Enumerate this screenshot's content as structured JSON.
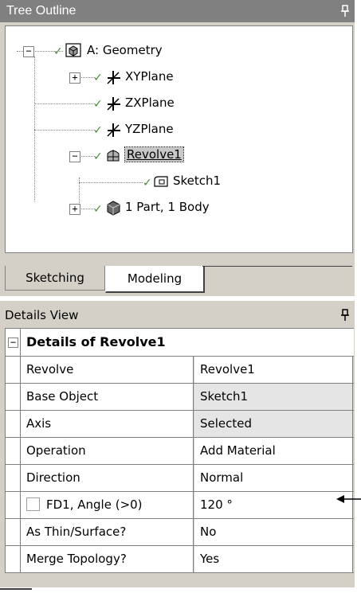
{
  "tree_panel": {
    "title": "Tree Outline",
    "nodes": [
      {
        "label": "A: Geometry",
        "expander": "−"
      },
      {
        "label": "XYPlane",
        "expander": "+"
      },
      {
        "label": "ZXPlane"
      },
      {
        "label": "YZPlane"
      },
      {
        "label": "Revolve1",
        "expander": "−",
        "selected": true
      },
      {
        "label": "Sketch1"
      },
      {
        "label": "1 Part, 1 Body",
        "expander": "+"
      }
    ],
    "tabs": {
      "sketching": "Sketching",
      "modeling": "Modeling",
      "active": "Modeling"
    }
  },
  "details_panel": {
    "title": "Details View",
    "header": "Details of Revolve1",
    "collapse": "−",
    "rows": [
      {
        "prop": "Revolve",
        "value": "Revolve1"
      },
      {
        "prop": "Base Object",
        "value": "Sketch1"
      },
      {
        "prop": "Axis",
        "value": "Selected"
      },
      {
        "prop": "Operation",
        "value": "Add Material"
      },
      {
        "prop": "Direction",
        "value": "Normal"
      },
      {
        "prop": "FD1,  Angle (>0)",
        "value": "120 °"
      },
      {
        "prop": "As Thin/Surface?",
        "value": "No"
      },
      {
        "prop": "Merge Topology?",
        "value": "Yes"
      }
    ]
  },
  "icons": [
    "pin-icon",
    "geometry-icon",
    "plane-icon",
    "revolve-icon",
    "sketch-icon",
    "body-icon",
    "check-icon",
    "arrow-left-icon"
  ],
  "colors": {
    "title_bar": "#808080",
    "panel_bg": "#d4d0c8",
    "gray_cell": "#e5e5e5",
    "check": "#4a8a3a"
  }
}
